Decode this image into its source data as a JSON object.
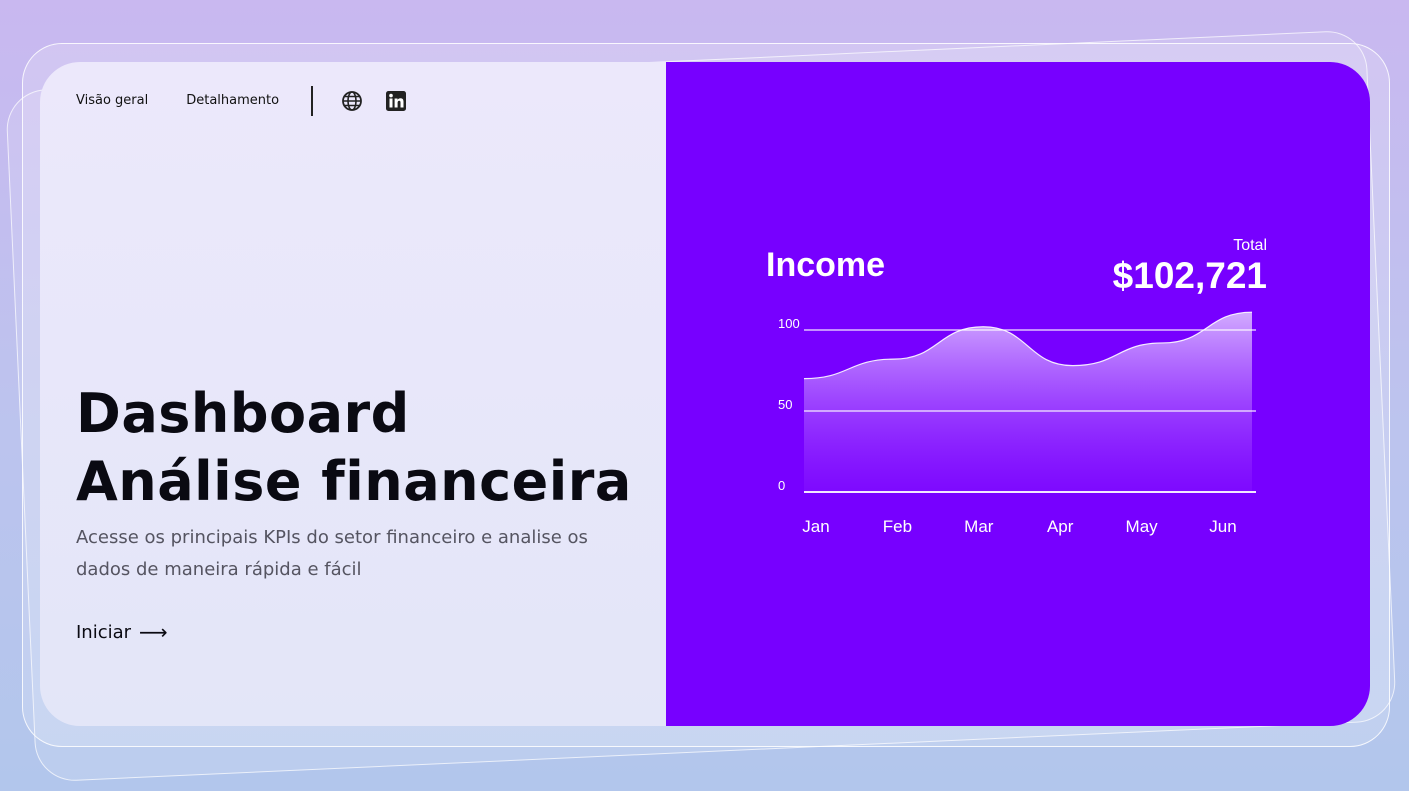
{
  "nav": {
    "links": [
      "Visão geral",
      "Detalhamento"
    ],
    "icons": [
      "globe-icon",
      "linkedin-icon"
    ]
  },
  "hero": {
    "title_line1": "Dashboard",
    "title_line2": "Análise financeira",
    "description": "Acesse os principais KPIs do setor financeiro e analise os dados de maneira rápida e fácil",
    "cta_label": "Iniciar",
    "cta_icon": "arrow-right-icon"
  },
  "income_card": {
    "title": "Income",
    "total_label": "Total",
    "total_value": "$102,721"
  },
  "colors": {
    "accent": "#7700ff",
    "left_bg": "#ece8fb",
    "text_dark": "#0a0a12"
  },
  "chart_data": {
    "type": "area",
    "title": "Income",
    "categories": [
      "Jan",
      "Feb",
      "Mar",
      "Apr",
      "May",
      "Jun"
    ],
    "values": [
      70,
      82,
      102,
      78,
      92,
      111
    ],
    "ylim": [
      0,
      100
    ],
    "yticks": [
      0,
      50,
      100
    ],
    "grid": true,
    "xlabel": "",
    "ylabel": ""
  }
}
